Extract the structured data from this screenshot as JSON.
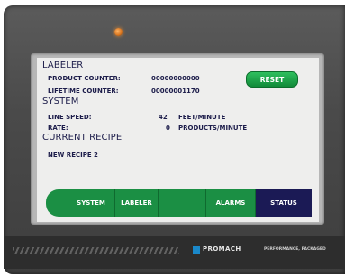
{
  "screen": {
    "labeler_header": "LABELER",
    "product_counter_label": "PRODUCT COUNTER:",
    "product_counter_value": "00000000000",
    "lifetime_counter_label": "LIFETIME COUNTER:",
    "lifetime_counter_value": "00000001170",
    "reset_label": "RESET",
    "system_header": "SYSTEM",
    "line_speed_label": "LINE SPEED:",
    "line_speed_value": "42",
    "line_speed_unit": "FEET/MINUTE",
    "rate_label": "RATE:",
    "rate_value": "0",
    "rate_unit": "PRODUCTS/MINUTE",
    "current_recipe_header": "CURRENT RECIPE",
    "recipe_name": "NEW RECIPE 2"
  },
  "tabs": {
    "system": "SYSTEM",
    "labeler": "LABELER",
    "blank": "",
    "alarms": "ALARMS",
    "status": "STATUS"
  },
  "device": {
    "brand": "PROMACH",
    "tagline": "PERFORMANCE, PACKAGED"
  },
  "colors": {
    "screen_bg": "#eeeeed",
    "text_navy": "#1c1c4a",
    "tab_green": "#1b8f44",
    "tab_active": "#1b1a55",
    "reset_green": "#2fbf5e",
    "indicator_orange": "#d7731d",
    "brand_blue": "#1a88c9"
  },
  "icons": {
    "indicator": "indicator-light-icon",
    "brand_mark": "promach-logo-icon"
  }
}
